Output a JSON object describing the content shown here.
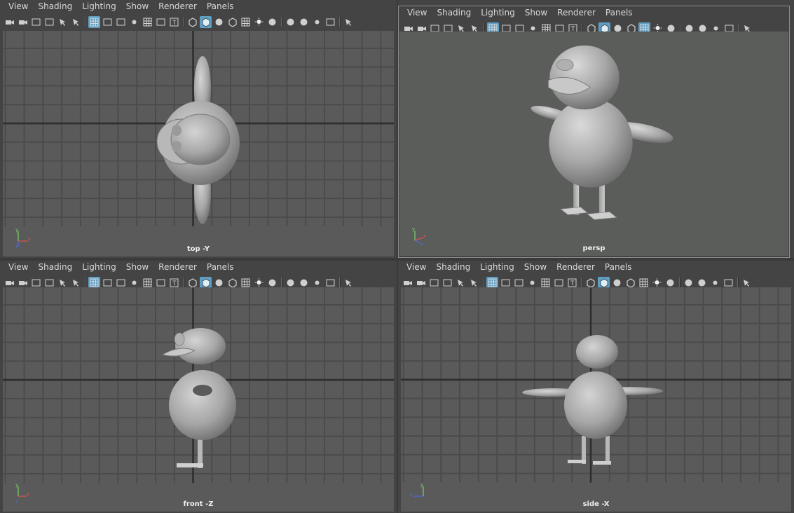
{
  "menus": [
    "View",
    "Shading",
    "Lighting",
    "Show",
    "Renderer",
    "Panels"
  ],
  "toolbar_icons": [
    "select-camera-icon",
    "camera-attributes-icon",
    "bookmark-icon",
    "image-plane-icon",
    "2d-pan-icon",
    "grease-pencil-icon",
    "|",
    "grid-icon",
    "film-gate-icon",
    "resolution-gate-icon",
    "gate-mask-icon",
    "field-chart-icon",
    "safe-action-icon",
    "safe-title-icon",
    "|",
    "wireframe-icon",
    "smooth-shade-icon",
    "use-default-material-icon",
    "wireframe-on-shaded-icon",
    "xray-icon",
    "use-all-lights-icon",
    "shadows-icon",
    "|",
    "screen-space-ambient-occlusion-icon",
    "motion-blur-icon",
    "multisample-aa-icon",
    "depth-of-field-icon",
    "|",
    "isolate-select-icon"
  ],
  "panels": [
    {
      "id": "top",
      "label": "top -Y",
      "axis_labels": [
        "y",
        "x",
        "z"
      ]
    },
    {
      "id": "persp",
      "label": "persp",
      "axis_labels": [
        "y",
        "x",
        "z"
      ]
    },
    {
      "id": "front",
      "label": "front -Z",
      "axis_labels": [
        "y",
        "x",
        "z"
      ]
    },
    {
      "id": "side",
      "label": "side -X",
      "axis_labels": [
        "y",
        "x",
        "z"
      ]
    }
  ],
  "colors": {
    "bg": "#444444",
    "viewport": "#5a5a5a",
    "grid": "#4a4a4a",
    "grid_major": "#2e2e2e",
    "accent": "#5e9fc5",
    "active_border": "#8d8d8d"
  }
}
